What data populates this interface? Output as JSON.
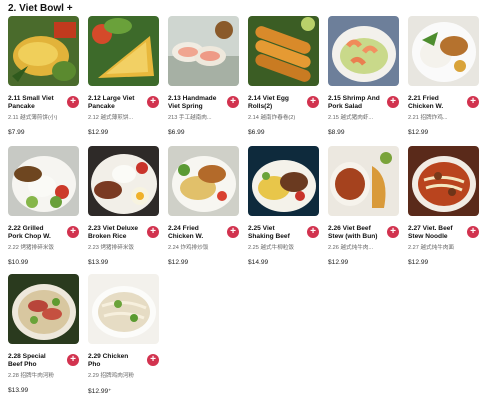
{
  "section": {
    "title": "2. Viet Bowl +"
  },
  "accent_color": "#d2334f",
  "add_icon": "plus-icon",
  "items": [
    {
      "name": "2.11 Small Viet Pancake",
      "cn": "2.11 越式薄煎饼(小)",
      "price": "$7.99"
    },
    {
      "name": "2.12 Large Viet Pancake",
      "cn": "2.12 越式薄煎饼...",
      "price": "$12.99"
    },
    {
      "name": "2.13 Handmade Viet Spring Rolls",
      "cn": "213 手工越南肉...",
      "price": "$6.99"
    },
    {
      "name": "2.14 Viet Egg Rolls(2)",
      "cn": "2.14 越南炸春卷(2)",
      "price": "$6.99"
    },
    {
      "name": "2.15 Shrimp And Pork Salad",
      "cn": "2.15 越式猪肉虾...",
      "price": "$8.99"
    },
    {
      "name": "2.21 Fried Chicken W. Burn...",
      "cn": "2.21 招牌炸鸡...",
      "price": "$12.99"
    },
    {
      "name": "2.22 Grilled Pork Chop W. Viet...",
      "cn": "2.22 烤猪排碎米饭",
      "price": "$10.99"
    },
    {
      "name": "2.23 Viet Deluxe Broken Rice",
      "cn": "2.23 烤猪排碎米饭",
      "price": "$13.99"
    },
    {
      "name": "2.24 Fried Chicken W. Viet...",
      "cn": "2.24 炸鸡排炒饭",
      "price": "$12.99"
    },
    {
      "name": "2.25 Viet Shaking Beef Rice",
      "cn": "2.25 越式牛柳粒饭",
      "price": "$14.99"
    },
    {
      "name": "2.26 Viet Beef Stew (with Bun)",
      "cn": "2.26 越式炖牛肉...",
      "price": "$12.99"
    },
    {
      "name": "2.27 Viet. Beef Stew Noodle",
      "cn": "2.27 越式炖牛肉面",
      "price": "$12.99"
    },
    {
      "name": "2.28 Special Beef Pho",
      "cn": "2.28 招牌牛肉河粉",
      "price": "$13.99"
    },
    {
      "name": "2.29 Chicken Pho",
      "cn": "2.29 招牌鸡肉河粉",
      "price": "$12.99⁺"
    }
  ]
}
